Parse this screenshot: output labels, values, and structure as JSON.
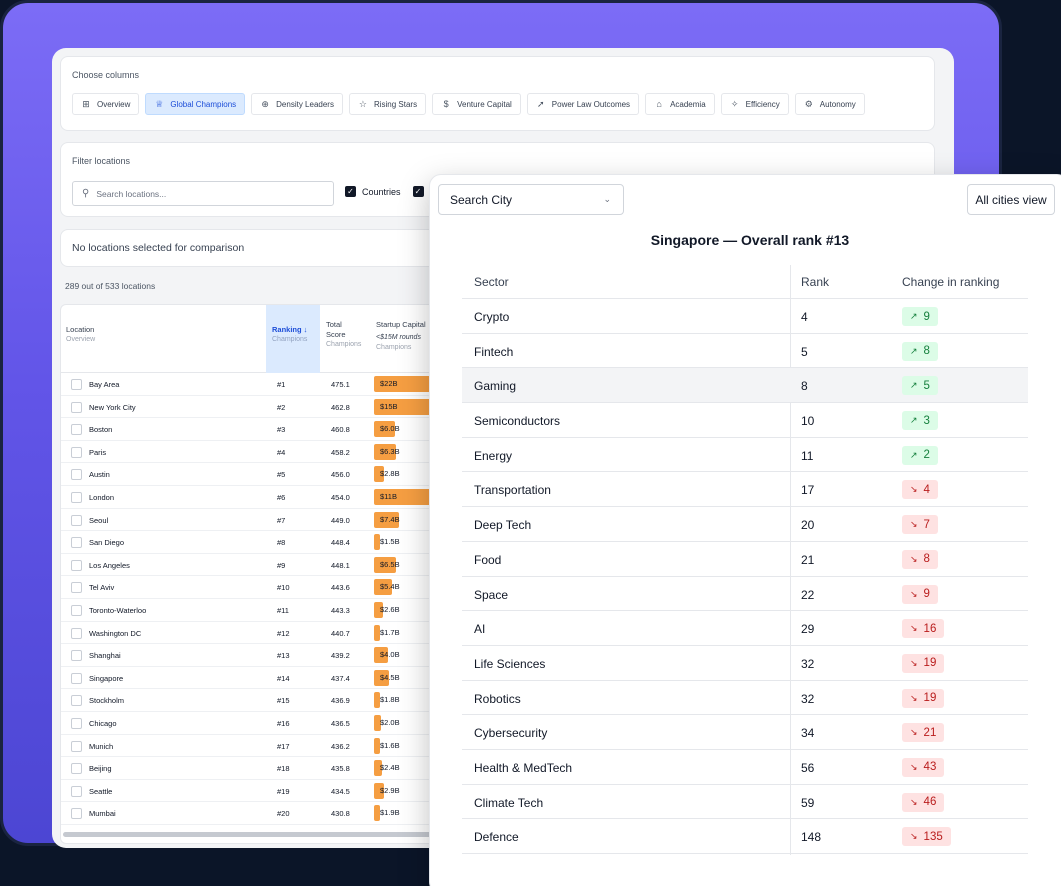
{
  "columns": {
    "label": "Choose columns",
    "chips": [
      {
        "label": "Overview",
        "icon": "grid-icon",
        "glyph": "⊞",
        "active": false,
        "w": 71
      },
      {
        "label": "Global Champions",
        "icon": "trophy-icon",
        "glyph": "♕",
        "active": true,
        "w": 96
      },
      {
        "label": "Density Leaders",
        "icon": "globe-icon",
        "glyph": "⊕",
        "active": false,
        "w": 88
      },
      {
        "label": "Rising Stars",
        "icon": "star-icon",
        "glyph": "☆",
        "active": false,
        "w": 73
      },
      {
        "label": "Venture Capital",
        "icon": "dollar-icon",
        "glyph": "$",
        "active": false,
        "w": 84
      },
      {
        "label": "Power Law Outcomes",
        "icon": "rocket-icon",
        "glyph": "➚",
        "active": false,
        "w": 108
      },
      {
        "label": "Academia",
        "icon": "school-icon",
        "glyph": "⌂",
        "active": false,
        "w": 68
      },
      {
        "label": "Efficiency",
        "icon": "sparkle-icon",
        "glyph": "✧",
        "active": false,
        "w": 68
      },
      {
        "label": "Autonomy",
        "icon": "gear-icon",
        "glyph": "⚙",
        "active": false,
        "w": 70
      }
    ]
  },
  "filter": {
    "label": "Filter locations",
    "search_placeholder": "Search locations...",
    "countries_label": "Countries"
  },
  "compare": {
    "text": "No locations selected for comparison"
  },
  "count_text": "289 out of 533 locations",
  "table": {
    "headers": {
      "location": "Location",
      "location_sub": "Overview",
      "ranking": "Ranking ↓",
      "ranking_sub": "Champions",
      "score_1": "Total",
      "score_2": "Score",
      "score_sub": "Champions",
      "capital": "Startup Capital",
      "capital_sub": "<$15M rounds",
      "capital_sub2": "Champions"
    },
    "rows": [
      {
        "loc": "Bay Area",
        "rank": "#1",
        "score": "475.1",
        "cap": "$22B",
        "frac": 1.0
      },
      {
        "loc": "New York City",
        "rank": "#2",
        "score": "462.8",
        "cap": "$15B",
        "frac": 1.0
      },
      {
        "loc": "Boston",
        "rank": "#3",
        "score": "460.8",
        "cap": "$6.0B",
        "frac": 0.36
      },
      {
        "loc": "Paris",
        "rank": "#4",
        "score": "458.2",
        "cap": "$6.3B",
        "frac": 0.38
      },
      {
        "loc": "Austin",
        "rank": "#5",
        "score": "456.0",
        "cap": "$2.8B",
        "frac": 0.17
      },
      {
        "loc": "London",
        "rank": "#6",
        "score": "454.0",
        "cap": "$11B",
        "frac": 1.0
      },
      {
        "loc": "Seoul",
        "rank": "#7",
        "score": "449.0",
        "cap": "$7.4B",
        "frac": 0.44
      },
      {
        "loc": "San Diego",
        "rank": "#8",
        "score": "448.4",
        "cap": "$1.5B",
        "frac": 0.09
      },
      {
        "loc": "Los Angeles",
        "rank": "#9",
        "score": "448.1",
        "cap": "$6.5B",
        "frac": 0.39
      },
      {
        "loc": "Tel Aviv",
        "rank": "#10",
        "score": "443.6",
        "cap": "$5.4B",
        "frac": 0.32
      },
      {
        "loc": "Toronto-Waterloo",
        "rank": "#11",
        "score": "443.3",
        "cap": "$2.6B",
        "frac": 0.16
      },
      {
        "loc": "Washington DC",
        "rank": "#12",
        "score": "440.7",
        "cap": "$1.7B",
        "frac": 0.1
      },
      {
        "loc": "Shanghai",
        "rank": "#13",
        "score": "439.2",
        "cap": "$4.0B",
        "frac": 0.24
      },
      {
        "loc": "Singapore",
        "rank": "#14",
        "score": "437.4",
        "cap": "$4.5B",
        "frac": 0.27
      },
      {
        "loc": "Stockholm",
        "rank": "#15",
        "score": "436.9",
        "cap": "$1.8B",
        "frac": 0.11
      },
      {
        "loc": "Chicago",
        "rank": "#16",
        "score": "436.5",
        "cap": "$2.0B",
        "frac": 0.12
      },
      {
        "loc": "Munich",
        "rank": "#17",
        "score": "436.2",
        "cap": "$1.6B",
        "frac": 0.1
      },
      {
        "loc": "Beijing",
        "rank": "#18",
        "score": "435.8",
        "cap": "$2.4B",
        "frac": 0.14
      },
      {
        "loc": "Seattle",
        "rank": "#19",
        "score": "434.5",
        "cap": "$2.9B",
        "frac": 0.17
      },
      {
        "loc": "Mumbai",
        "rank": "#20",
        "score": "430.8",
        "cap": "$1.9B",
        "frac": 0.11
      }
    ]
  },
  "panel": {
    "city_select": "Search City",
    "all_cities": "All cities view",
    "title": "Singapore — Overall rank #13",
    "headers": {
      "sector": "Sector",
      "rank": "Rank",
      "change": "Change in ranking"
    },
    "rows": [
      {
        "sector": "Crypto",
        "rank": "4",
        "change": "9",
        "dir": "up"
      },
      {
        "sector": "Fintech",
        "rank": "5",
        "change": "8",
        "dir": "up"
      },
      {
        "sector": "Gaming",
        "rank": "8",
        "change": "5",
        "dir": "up"
      },
      {
        "sector": "Semiconductors",
        "rank": "10",
        "change": "3",
        "dir": "up"
      },
      {
        "sector": "Energy",
        "rank": "11",
        "change": "2",
        "dir": "up"
      },
      {
        "sector": "Transportation",
        "rank": "17",
        "change": "4",
        "dir": "down"
      },
      {
        "sector": "Deep Tech",
        "rank": "20",
        "change": "7",
        "dir": "down"
      },
      {
        "sector": "Food",
        "rank": "21",
        "change": "8",
        "dir": "down"
      },
      {
        "sector": "Space",
        "rank": "22",
        "change": "9",
        "dir": "down"
      },
      {
        "sector": "AI",
        "rank": "29",
        "change": "16",
        "dir": "down"
      },
      {
        "sector": "Life Sciences",
        "rank": "32",
        "change": "19",
        "dir": "down"
      },
      {
        "sector": "Robotics",
        "rank": "32",
        "change": "19",
        "dir": "down"
      },
      {
        "sector": "Cybersecurity",
        "rank": "34",
        "change": "21",
        "dir": "down"
      },
      {
        "sector": "Health & MedTech",
        "rank": "56",
        "change": "43",
        "dir": "down"
      },
      {
        "sector": "Climate Tech",
        "rank": "59",
        "change": "46",
        "dir": "down"
      },
      {
        "sector": "Defence",
        "rank": "148",
        "change": "135",
        "dir": "down"
      }
    ]
  }
}
